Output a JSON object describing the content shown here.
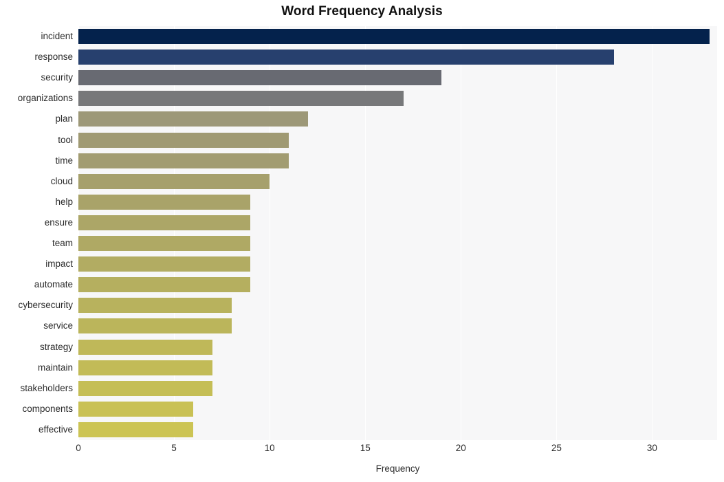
{
  "chart_data": {
    "type": "bar",
    "orientation": "horizontal",
    "title": "Word Frequency Analysis",
    "xlabel": "Frequency",
    "ylabel": "",
    "xlim": [
      0,
      33.4
    ],
    "xticks": [
      0,
      5,
      10,
      15,
      20,
      25,
      30
    ],
    "xtick_labels": [
      "0",
      "5",
      "10",
      "15",
      "20",
      "25",
      "30"
    ],
    "grid": "vertical-white-on-light-background",
    "legend": "none",
    "categories": [
      "incident",
      "response",
      "security",
      "organizations",
      "plan",
      "tool",
      "time",
      "cloud",
      "help",
      "ensure",
      "team",
      "impact",
      "automate",
      "cybersecurity",
      "service",
      "strategy",
      "maintain",
      "stakeholders",
      "components",
      "effective"
    ],
    "values": [
      33,
      28,
      19,
      17,
      12,
      11,
      11,
      10,
      9,
      9,
      9,
      9,
      9,
      8,
      8,
      7,
      7,
      7,
      6,
      6
    ],
    "bar_colors": [
      "#04224c",
      "#27406e",
      "#686a72",
      "#77787a",
      "#9d9878",
      "#a09a73",
      "#a29c71",
      "#a6a06c",
      "#a9a369",
      "#aca667",
      "#afa964",
      "#b2ac62",
      "#b5af5f",
      "#b8b25d",
      "#bbb55b",
      "#bfb859",
      "#c2bb57",
      "#c5be56",
      "#c9c155",
      "#ccc454"
    ],
    "plot_background": "#f7f7f8",
    "figure_background": "#ffffff",
    "title_color": "#111111",
    "tick_color": "#2b2b2b"
  }
}
